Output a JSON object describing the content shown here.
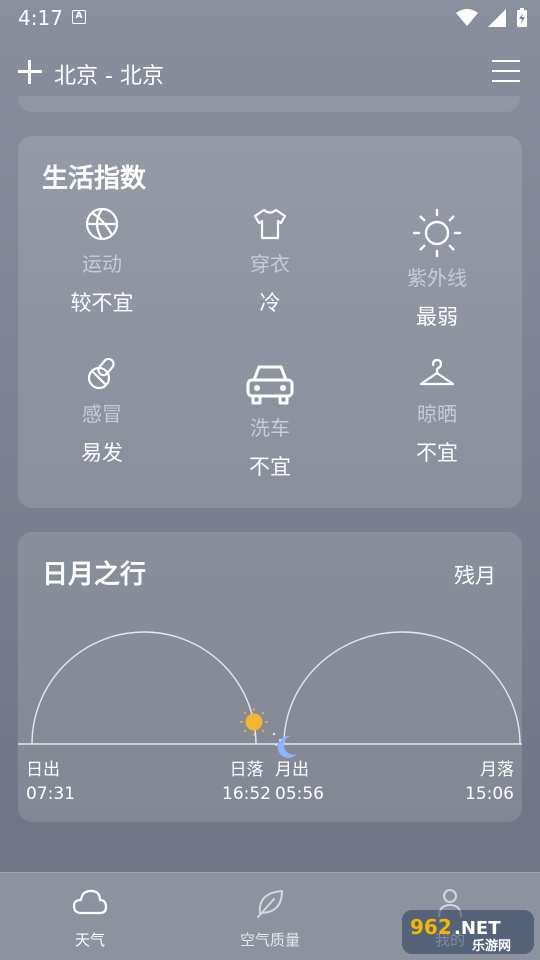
{
  "status": {
    "time": "4:17",
    "notif_glyph": "A"
  },
  "header": {
    "city": "北京 - 北京"
  },
  "life_index": {
    "title": "生活指数",
    "items": [
      {
        "icon": "basketball-icon",
        "label": "运动",
        "value": "较不宜"
      },
      {
        "icon": "tshirt-icon",
        "label": "穿衣",
        "value": "冷"
      },
      {
        "icon": "sun-icon",
        "label": "紫外线",
        "value": "最弱"
      },
      {
        "icon": "pill-icon",
        "label": "感冒",
        "value": "易发"
      },
      {
        "icon": "car-icon",
        "label": "洗车",
        "value": "不宜"
      },
      {
        "icon": "hanger-icon",
        "label": "晾晒",
        "value": "不宜"
      }
    ]
  },
  "sun_moon": {
    "title": "日月之行",
    "moon_phase": "残月",
    "sunrise_label": "日出",
    "sunrise_time": "07:31",
    "sunset_label": "日落",
    "sunset_time": "16:52",
    "moonrise_label": "月出",
    "moonrise_time": "05:56",
    "moonset_label": "月落",
    "moonset_time": "15:06"
  },
  "tabs": [
    {
      "label": "天气",
      "icon": "cloud-icon"
    },
    {
      "label": "空气质量",
      "icon": "leaf-icon"
    },
    {
      "label": "我的",
      "icon": "user-icon"
    }
  ],
  "watermark": {
    "brand": "962.NET",
    "sub": "乐游网"
  },
  "colors": {
    "sun": "#f2b632",
    "moon": "#8fb4ff",
    "arc": "#e6e8ee"
  }
}
